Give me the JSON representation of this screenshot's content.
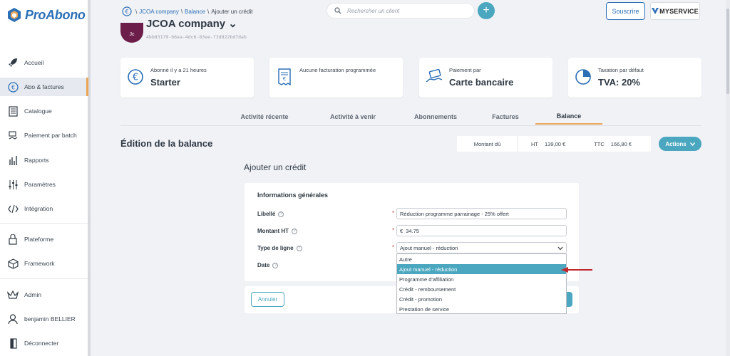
{
  "app": {
    "logo_text": "ProAbono",
    "brand_color": "#2b6fb6",
    "accent": "#4aa7bf",
    "highlight": "#e8a65a"
  },
  "sidebar": {
    "items": [
      {
        "label": "Accueil",
        "icon": "rocket-icon"
      },
      {
        "label": "Abo & factures",
        "icon": "euro-icon",
        "active": true
      },
      {
        "label": "Catalogue",
        "icon": "catalog-icon"
      },
      {
        "label": "Paiement par batch",
        "icon": "batch-payment-icon"
      },
      {
        "label": "Rapports",
        "icon": "reports-icon"
      },
      {
        "label": "Paramètres",
        "icon": "settings-sliders-icon"
      },
      {
        "label": "Intégration",
        "icon": "code-icon"
      },
      {
        "label": "Plateforme",
        "icon": "platform-icon"
      },
      {
        "label": "Framework",
        "icon": "cube-icon"
      },
      {
        "label": "Admin",
        "icon": "crown-icon"
      },
      {
        "label": "benjamin BELLIER",
        "icon": "user-icon"
      },
      {
        "label": "Déconnecter",
        "icon": "logout-icon"
      }
    ]
  },
  "header": {
    "breadcrumb": {
      "company": "JCOA company",
      "sep1": "\\",
      "balance": "Balance",
      "sep2": "\\",
      "current": "Ajouter un crédit"
    },
    "search_placeholder": "Rechercher un client",
    "plus_label": "+",
    "subscribe_label": "Souscrire",
    "partner_label": "MYSERVICE"
  },
  "company": {
    "initials": "Jc",
    "name": "JCOA company ⌄",
    "id": "4bb83179-b6ea-4dc6-83ee-f3d822bd7dab"
  },
  "cards": [
    {
      "small": "Abonné il y a 21 heures",
      "big": "Starter",
      "icon": "euro-circle-icon"
    },
    {
      "small": "Aucune facturation programmée",
      "big": "",
      "icon": "invoice-icon"
    },
    {
      "small": "Paiement par",
      "big": "Carte bancaire",
      "icon": "card-payment-icon"
    },
    {
      "small": "Taxation par défaut",
      "big": "TVA: 20%",
      "icon": "pie-chart-icon"
    }
  ],
  "tabs": [
    {
      "label": "Activité récente"
    },
    {
      "label": "Activité à venir"
    },
    {
      "label": "Abonnements"
    },
    {
      "label": "Factures"
    },
    {
      "label": "Balance",
      "active": true
    }
  ],
  "balance": {
    "title": "Édition de la balance",
    "amount_label": "Montant dû",
    "ht_label": "HT",
    "ht_value": "139,00 €",
    "ttc_label": "TTC",
    "ttc_value": "166,80 €",
    "actions_label": "Actions"
  },
  "form": {
    "title": "Ajouter un crédit",
    "section": "Informations générales",
    "fields": {
      "libelle": {
        "label": "Libellé",
        "value": "Réduction programme parrainage - 25% offert"
      },
      "montant": {
        "label": "Montant HT",
        "currency": "€",
        "value": "34.75"
      },
      "type": {
        "label": "Type de ligne",
        "value": "Ajout manuel - réduction"
      },
      "date": {
        "label": "Date"
      }
    },
    "required_mark": "*",
    "help_mark": "?",
    "dropdown_options": [
      "Autre",
      "Ajout manuel - réduction",
      "Programme d'affiliation",
      "Crédit - remboursement",
      "Crédit - promotion",
      "Prestation de service"
    ],
    "selected_index": 1,
    "cancel_label": "Annuler"
  }
}
